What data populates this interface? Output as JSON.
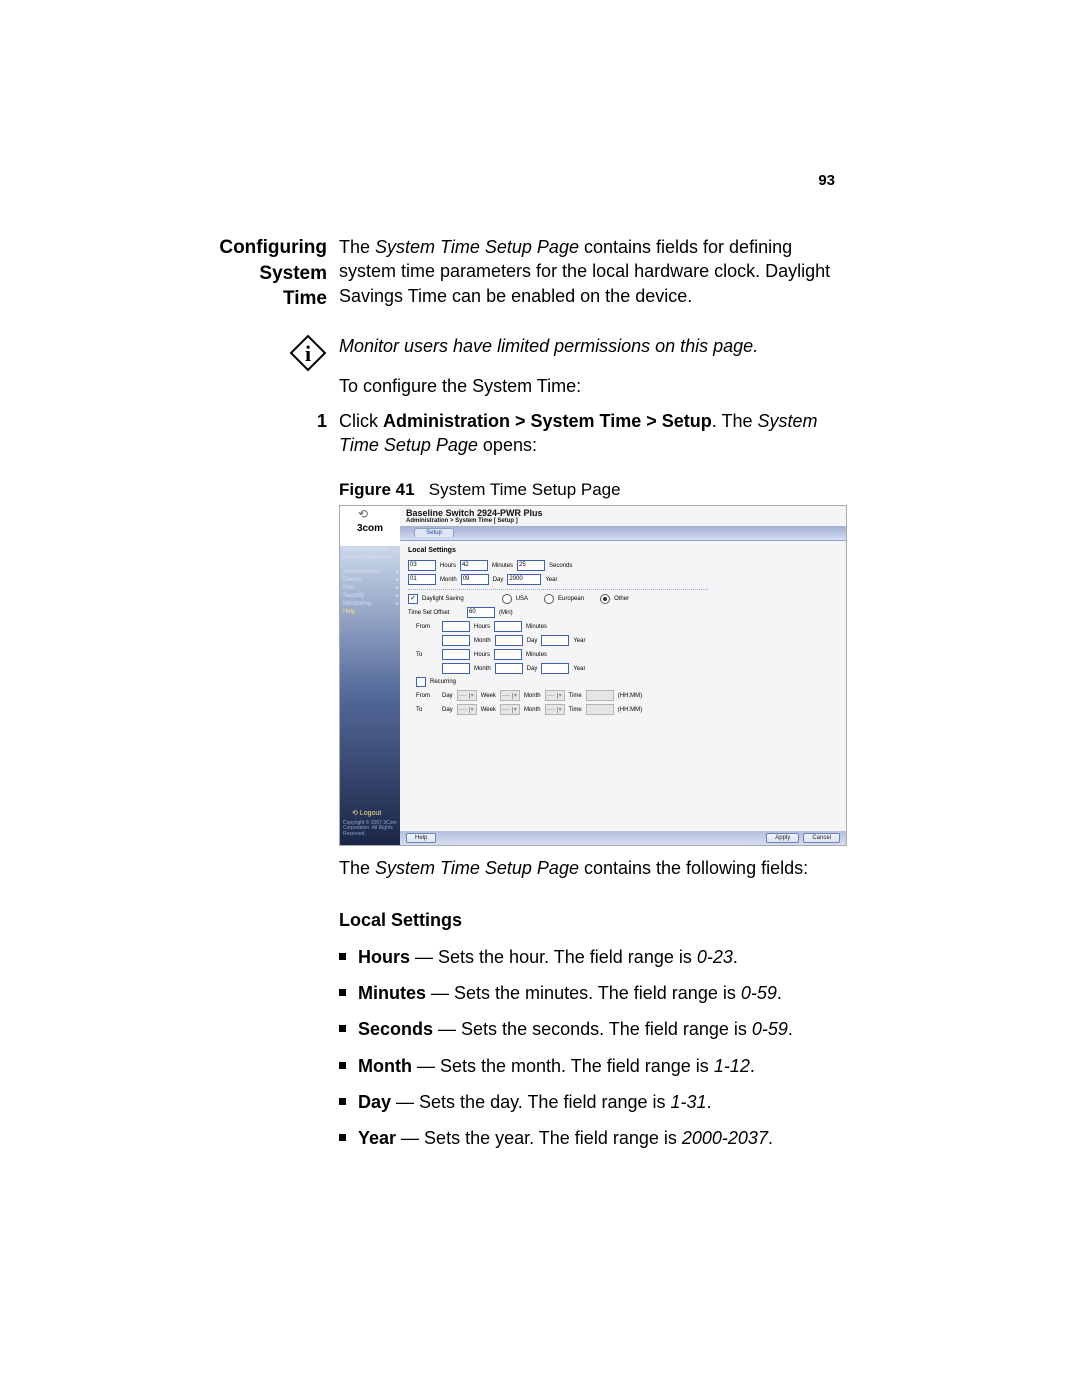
{
  "page_number": "93",
  "section_title_line1": "Configuring System",
  "section_title_line2": "Time",
  "intro_p1_a": "The ",
  "intro_p1_b": "System Time Setup Page",
  "intro_p1_c": " contains fields for defining system time parameters for the local hardware clock. Daylight Savings Time can be enabled on the device.",
  "info_note": "Monitor users have limited permissions on this page.",
  "lead_in": "To configure the System Time:",
  "step1_num": "1",
  "step1_a": "Click ",
  "step1_b": "Administration > System Time > Setup",
  "step1_c": ". The ",
  "step1_d": "System Time Setup Page",
  "step1_e": " opens:",
  "figure_label": "Figure 41",
  "figure_caption": "System Time Setup Page",
  "after_fig_a": "The ",
  "after_fig_b": "System Time Setup Page",
  "after_fig_c": " contains the following fields:",
  "subhead": "Local Settings",
  "b1_a": "Hours",
  "b1_b": " — Sets the hour. The field range is ",
  "b1_c": "0-23",
  "b1_d": ".",
  "b2_a": "Minutes",
  "b2_b": " — Sets the minutes. The field range is ",
  "b2_c": "0-59",
  "b2_d": ".",
  "b3_a": "Seconds",
  "b3_b": " — Sets the seconds. The field range is ",
  "b3_c": "0-59",
  "b3_d": ".",
  "b4_a": "Month",
  "b4_b": " — Sets the month. The field range is ",
  "b4_c": "1-12",
  "b4_d": ".",
  "b5_a": "Day",
  "b5_b": " — Sets the day. The field range is ",
  "b5_c": "1-31",
  "b5_d": ".",
  "b6_a": "Year",
  "b6_b": " — Sets the year. The field range is ",
  "b6_c": "2000-2037",
  "b6_d": ".",
  "screenshot": {
    "logo": "3com",
    "device_title": "Baseline Switch 2924-PWR Plus",
    "breadcrumb": "Administration > System Time [ Setup ]",
    "tab": "Setup",
    "nav": {
      "device_summary": "Device Summary",
      "save_config": "Save Configuration",
      "administration": "Administration",
      "device": "Device",
      "port": "Port",
      "security": "Security",
      "monitoring": "Monitoring",
      "help": "Help"
    },
    "logout": "Logout",
    "copyright": "Copyright © 2007\n3Com Corporation.\nAll Rights Reserved.",
    "section": "Local Settings",
    "hours_val": "03",
    "hours_lbl": "Hours",
    "minutes_val": "42",
    "minutes_lbl": "Minutes",
    "seconds_val": "25",
    "seconds_lbl": "Seconds",
    "month_val": "01",
    "month_lbl": "Month",
    "day_val": "09",
    "day_lbl": "Day",
    "year_val": "2000",
    "year_lbl": "Year",
    "daylight_lbl": "Daylight Saving",
    "usa": "USA",
    "european": "European",
    "other": "Other",
    "offset_lbl": "Time Set Offset",
    "offset_val": "60",
    "offset_unit": "(Min)",
    "from": "From",
    "to": "To",
    "hours2": "Hours",
    "month2": "Month",
    "minutes2": "Minutes",
    "day2": "Day",
    "year2": "Year",
    "recurring": "Recurring",
    "r_day": "Day",
    "r_week": "Week",
    "r_month": "Month",
    "r_time": "Time",
    "r_hhmm": "(HH:MM)",
    "dd_blank": "----",
    "btn_help": "Help",
    "btn_apply": "Apply",
    "btn_cancel": "Cancel"
  }
}
